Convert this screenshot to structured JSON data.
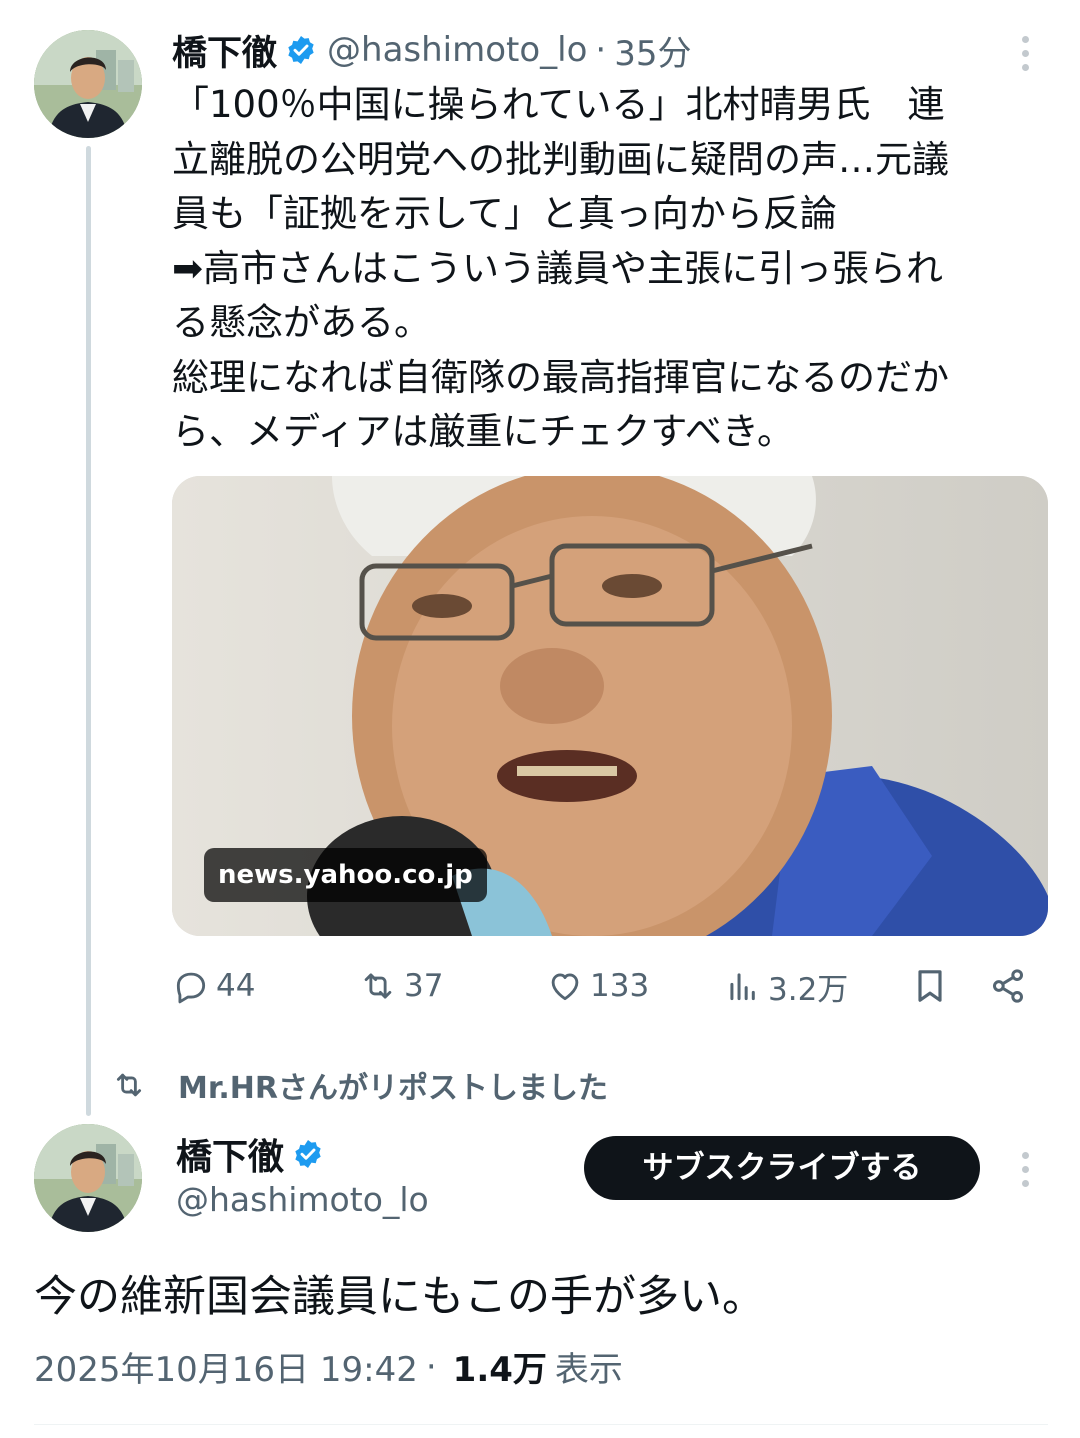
{
  "colors": {
    "accent": "#1d9bf0",
    "text": "#0f1419",
    "muted": "#536471",
    "button_bg": "#0f1419"
  },
  "quoted_tweet": {
    "author_name": "橋下徹",
    "handle": "@hashimoto_lo",
    "separator": "·",
    "time": "35分",
    "text_lines": [
      "「100％中国に操られている」北村晴男氏　連",
      "立離脱の公明党への批判動画に疑問の声…元議",
      "員も「証拠を示して」と真っ向から反論",
      "➡高市さんはこういう議員や主張に引っ張られ",
      "る懸念がある。",
      "総理になれば自衛隊の最高指揮官になるのだか",
      "ら、メディアは厳重にチェクすべき。"
    ],
    "link_card": {
      "domain": "news.yahoo.co.jp"
    },
    "actions": {
      "replies": "44",
      "reposts": "37",
      "likes": "133",
      "views": "3.2万"
    }
  },
  "repost_banner": {
    "label": "Mr.HRさんがリポストしました"
  },
  "main_tweet": {
    "author_name": "橋下徹",
    "handle": "@hashimoto_lo",
    "subscribe_label": "サブスクライブする",
    "text": "今の維新国会議員にもこの手が多い。",
    "timestamp": "2025年10月16日 19:42",
    "separator": "·",
    "views_count": "1.4万",
    "views_label": "表示"
  }
}
